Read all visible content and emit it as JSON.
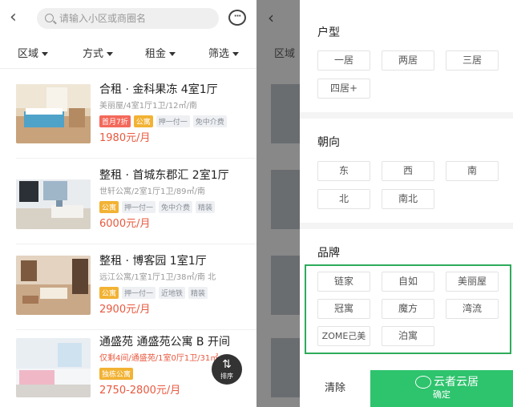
{
  "search": {
    "placeholder": "请输入小区或商圈名"
  },
  "filters": [
    "区域",
    "方式",
    "租金",
    "筛选"
  ],
  "listings": [
    {
      "title": "合租 · 金科果冻 4室1厅",
      "sub": "美丽屋/4室1厅1卫/12㎡/南",
      "tags": [
        {
          "text": "首月7折",
          "style": "red"
        },
        {
          "text": "公寓",
          "style": "yellow"
        },
        {
          "text": "押一付一",
          "style": "grey"
        },
        {
          "text": "免中介费",
          "style": "grey"
        }
      ],
      "price": "1980元/月"
    },
    {
      "title": "整租 · 首城东郡汇 2室1厅",
      "sub": "世轩公寓/2室1厅1卫/89㎡/南",
      "tags": [
        {
          "text": "公寓",
          "style": "yellow"
        },
        {
          "text": "押一付一",
          "style": "grey"
        },
        {
          "text": "免中介费",
          "style": "grey"
        },
        {
          "text": "精装",
          "style": "grey"
        }
      ],
      "price": "6000元/月"
    },
    {
      "title": "整租 · 博客园 1室1厅",
      "sub": "远江公寓/1室1厅1卫/38㎡/南 北",
      "tags": [
        {
          "text": "公寓",
          "style": "yellow"
        },
        {
          "text": "押一付一",
          "style": "grey"
        },
        {
          "text": "近地铁",
          "style": "grey"
        },
        {
          "text": "精装",
          "style": "grey"
        }
      ],
      "price": "2900元/月"
    },
    {
      "title": "通盛苑 通盛苑公寓 B 开间",
      "sub": "仅剩4间/通盛苑/1室0厅1卫/31㎡",
      "tags": [
        {
          "text": "独栋公寓",
          "style": "yellow"
        }
      ],
      "price": "2750-2800元/月"
    }
  ],
  "sort_button": {
    "icon": "sort-arrows-icon",
    "label": "排序"
  },
  "drawer": {
    "huxing": {
      "title": "户型",
      "options": [
        "一居",
        "两居",
        "三居",
        "四居+"
      ]
    },
    "chaoxiang": {
      "title": "朝向",
      "options": [
        "东",
        "西",
        "南",
        "北",
        "南北"
      ]
    },
    "pinpai": {
      "title": "品牌",
      "options": [
        "链家",
        "自如",
        "美丽屋",
        "冠寓",
        "魔方",
        "湾流",
        "ZOME己美",
        "泊寓"
      ]
    },
    "clear_label": "清除",
    "confirm_label": "确定"
  },
  "watermark": {
    "text": "云者云居",
    "icon": "wechat-icon"
  },
  "colors": {
    "accent": "#2ec36d",
    "highlight_border": "#2eab5b",
    "price": "#e8593f",
    "tag_red": "#f3695b",
    "tag_yellow": "#f2b233"
  }
}
